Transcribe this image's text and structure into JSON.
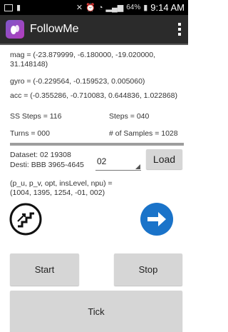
{
  "status_bar": {
    "battery": "64%",
    "time": "9:14 AM"
  },
  "action_bar": {
    "title": "FollowMe"
  },
  "sensors": {
    "mag": "mag = (-23.879999, -6.180000, -19.020000, 31.148148)",
    "gyro": "gyro = (-0.229564, -0.159523, 0.005060)",
    "acc": "acc = (-0.355286, -0.710083, 0.644836, 1.022868)"
  },
  "stats": {
    "ss_steps": "SS Steps = 116",
    "steps": "Steps = 040",
    "turns": "Turns = 000",
    "samples": "# of Samples = 1028"
  },
  "dataset": {
    "dataset_label": "Dataset: 02 19308",
    "desti_label": "Desti: BBB 3965-4645",
    "selected": "02",
    "load_label": "Load"
  },
  "params": {
    "line1": "(p_u, p_v, opt, insLevel, npu) =",
    "line2": "(1004, 1395, 1254, -01, 002)"
  },
  "controls": {
    "start_label": "Start",
    "stop_label": "Stop",
    "tick_label": "Tick"
  },
  "colors": {
    "accent_blue": "#1a73c9",
    "button_gray": "#d6d6d6",
    "action_bar": "#2b2b2b"
  },
  "icons": {
    "stairs": "stairs-icon",
    "forward": "arrow-right-icon"
  }
}
